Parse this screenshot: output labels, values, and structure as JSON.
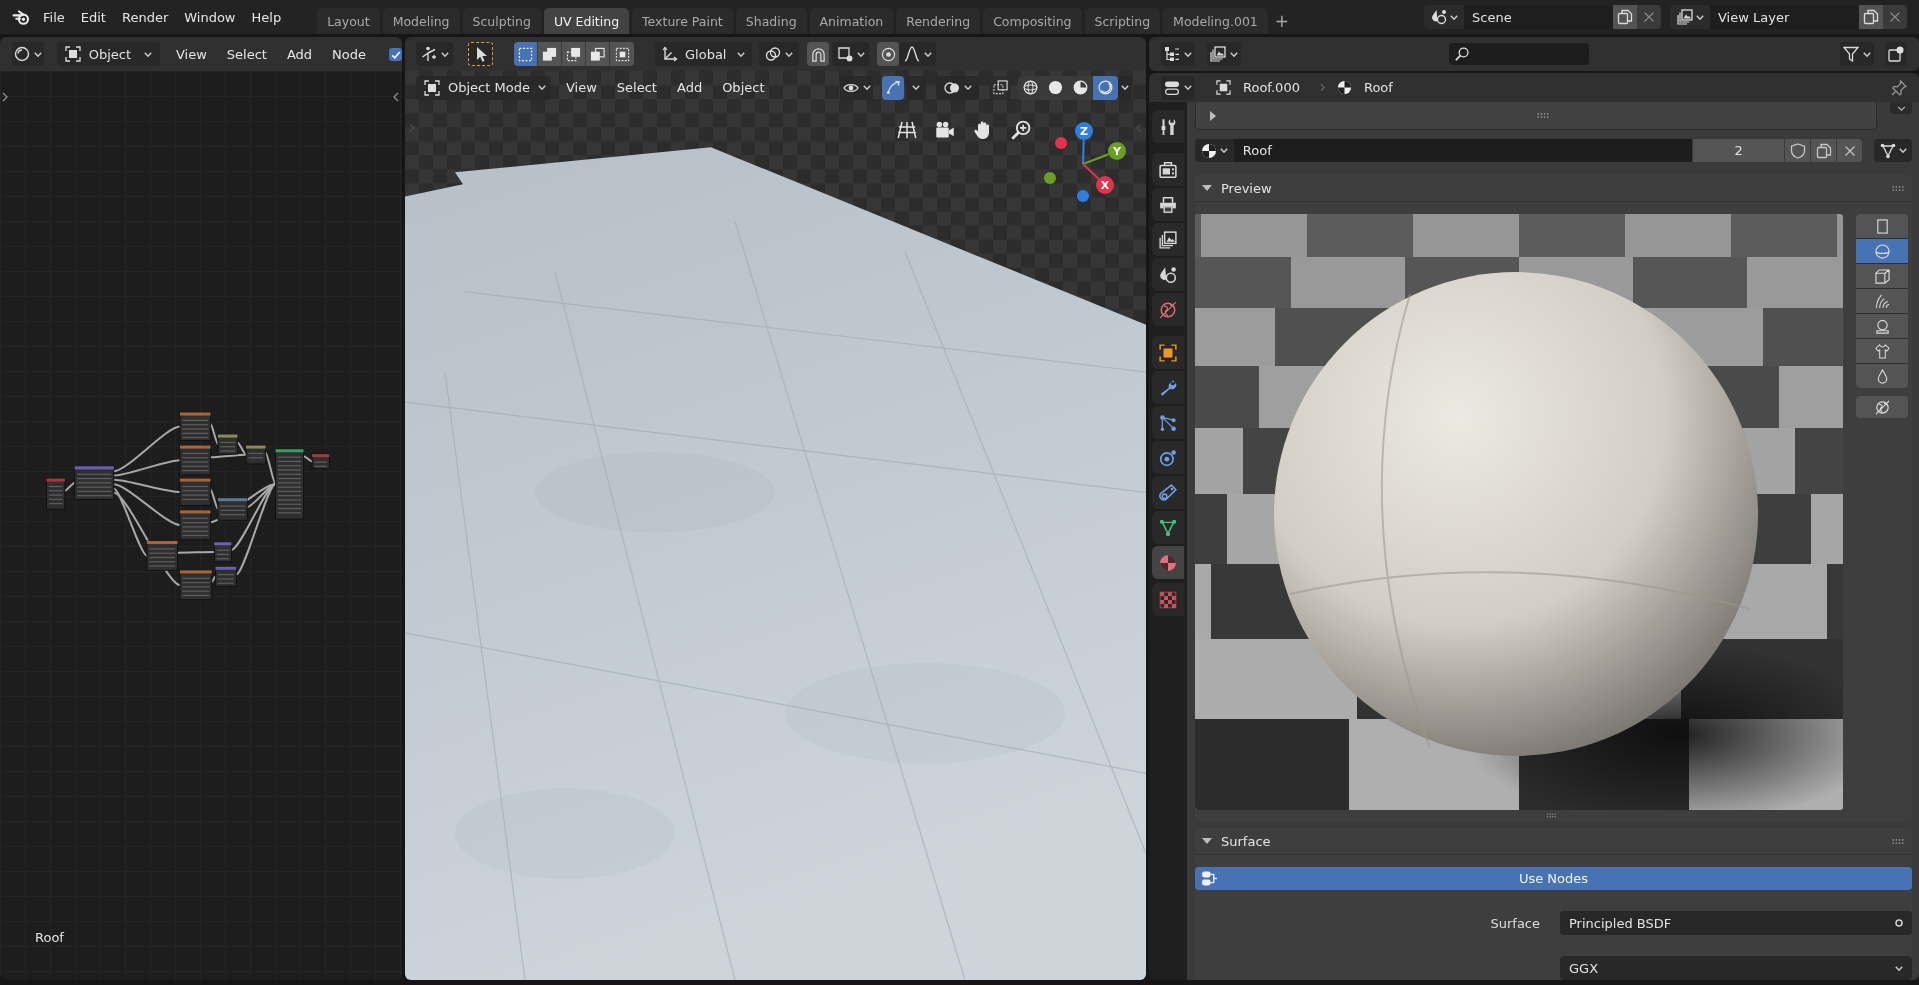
{
  "top_bar": {
    "menu": [
      "File",
      "Edit",
      "Render",
      "Window",
      "Help"
    ],
    "workspaces": [
      {
        "label": "Layout",
        "selected": false
      },
      {
        "label": "Modeling",
        "selected": false
      },
      {
        "label": "Sculpting",
        "selected": false
      },
      {
        "label": "UV Editing",
        "selected": true
      },
      {
        "label": "Texture Paint",
        "selected": false
      },
      {
        "label": "Shading",
        "selected": false
      },
      {
        "label": "Animation",
        "selected": false
      },
      {
        "label": "Rendering",
        "selected": false
      },
      {
        "label": "Compositing",
        "selected": false
      },
      {
        "label": "Scripting",
        "selected": false
      },
      {
        "label": "Modeling.001",
        "selected": false
      }
    ],
    "add_workspace": "+",
    "scene": "Scene",
    "view_layer": "View Layer"
  },
  "node_editor": {
    "object_type": "Object",
    "menu": [
      "View",
      "Select",
      "Add",
      "Node"
    ],
    "use_nodes": {
      "checked": true
    },
    "material_label": "Roof"
  },
  "viewport": {
    "select_modes": [
      {
        "kind": "set",
        "selected": true
      },
      {
        "kind": "extend",
        "selected": false
      },
      {
        "kind": "subtract",
        "selected": false
      },
      {
        "kind": "invert",
        "selected": false
      },
      {
        "kind": "intersect",
        "selected": false
      }
    ],
    "orientation": "Global",
    "mode": "Object Mode",
    "menu": [
      "View",
      "Select",
      "Add",
      "Object"
    ],
    "show_gizmo": {
      "on": true
    },
    "shading_modes": [
      {
        "kind": "wireframe",
        "selected": false
      },
      {
        "kind": "solid",
        "selected": false
      },
      {
        "kind": "material",
        "selected": false
      },
      {
        "kind": "rendered",
        "selected": true
      }
    ],
    "gizmo_axes": [
      {
        "label": "Z",
        "color": "#2f7fe2"
      },
      {
        "label": "Y",
        "color": "#6b9f1f"
      },
      {
        "label": "X",
        "color": "#e3324c"
      }
    ]
  },
  "properties": {
    "breadcrumb": [
      {
        "kind": "object",
        "label": "Roof.000"
      },
      {
        "kind": "material",
        "label": "Roof"
      }
    ],
    "tab_groups": [
      {
        "tabs": [
          {
            "kind": "tool",
            "selected": false
          }
        ]
      },
      {
        "tabs": [
          {
            "kind": "render",
            "selected": false
          },
          {
            "kind": "output",
            "selected": false
          },
          {
            "kind": "view_layer",
            "selected": false
          },
          {
            "kind": "scene",
            "selected": false
          },
          {
            "kind": "world",
            "selected": false
          }
        ]
      },
      {
        "tabs": [
          {
            "kind": "object",
            "selected": false
          },
          {
            "kind": "modifiers",
            "selected": false
          },
          {
            "kind": "particles",
            "selected": false
          },
          {
            "kind": "physics",
            "selected": false
          },
          {
            "kind": "constraints",
            "selected": false
          },
          {
            "kind": "data",
            "selected": false
          },
          {
            "kind": "material",
            "selected": true
          }
        ]
      },
      {
        "tabs": [
          {
            "kind": "texture",
            "selected": false
          }
        ]
      }
    ],
    "material": {
      "name": "Roof",
      "users": "2"
    },
    "preview": {
      "title": "Preview",
      "expanded": true,
      "shapes": [
        {
          "kind": "flat",
          "selected": false
        },
        {
          "kind": "sphere",
          "selected": true
        },
        {
          "kind": "cube",
          "selected": false
        },
        {
          "kind": "hair",
          "selected": false
        },
        {
          "kind": "shader_ball",
          "selected": false
        },
        {
          "kind": "cloth",
          "selected": false
        },
        {
          "kind": "fluid",
          "selected": false
        }
      ]
    },
    "surface": {
      "title": "Surface",
      "expanded": true,
      "use_nodes": {
        "label": "Use Nodes",
        "on": true
      },
      "fields": [
        {
          "kind": "link",
          "label": "Surface",
          "value": "Principled BSDF"
        },
        {
          "kind": "dropdown",
          "value": "GGX"
        }
      ]
    }
  }
}
